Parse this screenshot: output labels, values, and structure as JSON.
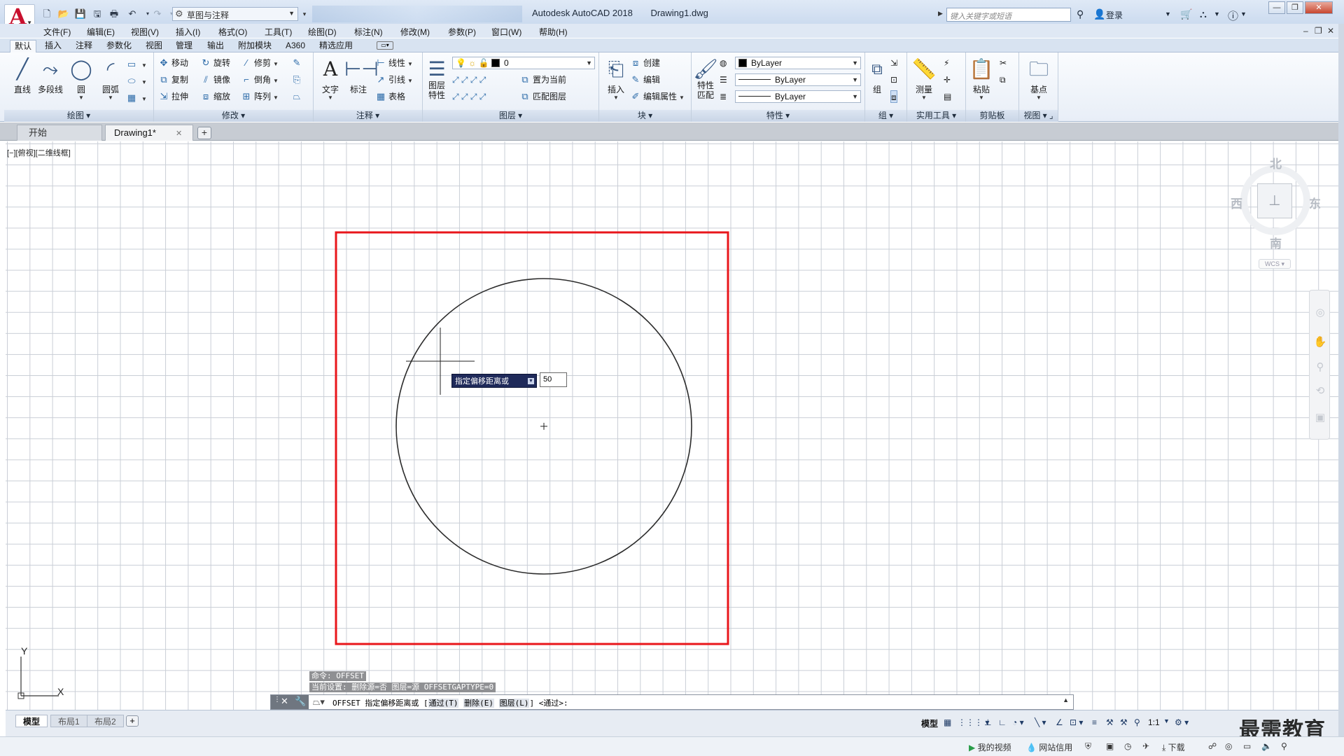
{
  "titlebar": {
    "workspace": "草图与注释",
    "app_name": "Autodesk AutoCAD 2018",
    "file_name": "Drawing1.dwg",
    "search_placeholder": "键入关键字或短语",
    "login": "登录"
  },
  "menu": {
    "items": [
      "文件(F)",
      "编辑(E)",
      "视图(V)",
      "插入(I)",
      "格式(O)",
      "工具(T)",
      "绘图(D)",
      "标注(N)",
      "修改(M)",
      "参数(P)",
      "窗口(W)",
      "帮助(H)"
    ]
  },
  "ribbon_tabs": [
    "默认",
    "插入",
    "注释",
    "参数化",
    "视图",
    "管理",
    "输出",
    "附加模块",
    "A360",
    "精选应用"
  ],
  "ribbon": {
    "draw": {
      "title": "绘图",
      "line": "直线",
      "polyline": "多段线",
      "circle": "圆",
      "arc": "圆弧"
    },
    "modify": {
      "title": "修改",
      "move": "移动",
      "rotate": "旋转",
      "trim": "修剪",
      "copy": "复制",
      "mirror": "镜像",
      "fillet": "倒角",
      "stretch": "拉伸",
      "scale": "缩放",
      "array": "阵列"
    },
    "annotation": {
      "title": "注释",
      "text": "文字",
      "dimension": "标注",
      "linear": "线性",
      "leader": "引线",
      "table": "表格"
    },
    "layers": {
      "title": "图层",
      "layer_props_1": "图层",
      "layer_props_2": "特性",
      "current_layer": "0",
      "set_current": "置为当前",
      "match_layer": "匹配图层"
    },
    "block": {
      "title": "块",
      "insert": "插入",
      "create": "创建",
      "edit": "编辑",
      "edit_attr": "编辑属性"
    },
    "properties": {
      "title": "特性",
      "match_1": "特性",
      "match_2": "匹配",
      "color": "ByLayer",
      "linetype": "ByLayer",
      "lineweight": "ByLayer"
    },
    "groups": {
      "title": "组",
      "group": "组"
    },
    "utilities": {
      "title": "实用工具",
      "measure": "测量"
    },
    "clipboard": {
      "title": "剪贴板",
      "paste": "粘贴"
    },
    "view": {
      "title": "视图",
      "base": "基点"
    }
  },
  "file_tabs": {
    "start": "开始",
    "drawing": "Drawing1*"
  },
  "viewport_label": "[−][俯视][二维线框]",
  "dynamic_input": {
    "prompt": "指定偏移距离或",
    "value": "50"
  },
  "viewcube": {
    "north": "北",
    "south": "南",
    "east": "东",
    "west": "西",
    "wcs": "WCS"
  },
  "ucs": {
    "x": "X",
    "y": "Y"
  },
  "command": {
    "history": [
      "命令: OFFSET",
      "当前设置: 删除源=否  图层=源  OFFSETGAPTYPE=0"
    ],
    "prompt_lead": "OFFSET 指定偏移距离或 [",
    "opt_through": "通过(T)",
    "opt_erase": "删除(E)",
    "opt_layer": "图层(L)",
    "prompt_tail": "] <通过>:"
  },
  "layout_tabs": [
    "模型",
    "布局1",
    "布局2"
  ],
  "status": {
    "model": "模型",
    "scale": "1:1"
  },
  "os_bar": {
    "my_video": "我的视频",
    "network": "网站信用",
    "download": "下载"
  },
  "watermark": "最需教育",
  "colors": {
    "highlight_rect": "#e8161b",
    "circle": "#2b2b2b",
    "prompt_bg": "#1f2a5a"
  }
}
